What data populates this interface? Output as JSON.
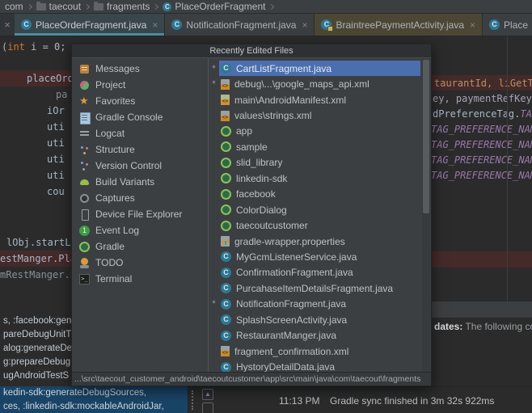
{
  "breadcrumb": {
    "items": [
      {
        "label": "com"
      },
      {
        "label": "taecout"
      },
      {
        "label": "fragments"
      },
      {
        "label": "PlaceOrderFragment"
      }
    ]
  },
  "tabs": [
    {
      "label": "PlaceOrderFragment.java",
      "close": "×",
      "state": "selected"
    },
    {
      "label": "NotificationFragment.java",
      "close": "×",
      "state": "normal"
    },
    {
      "label": "BraintreePaymentActivity.java",
      "close": "×",
      "state": "readonly"
    },
    {
      "label": "Place",
      "close": "",
      "state": "partial"
    }
  ],
  "leading_close": "×",
  "popup": {
    "title": "Recently Edited Files",
    "tool_windows": [
      {
        "label": "Messages",
        "icon": "messages-icon"
      },
      {
        "label": "Project",
        "icon": "project-icon"
      },
      {
        "label": "Favorites",
        "icon": "star-icon"
      },
      {
        "label": "Gradle Console",
        "icon": "gradle-console-icon"
      },
      {
        "label": "Logcat",
        "icon": "logcat-icon"
      },
      {
        "label": "Structure",
        "icon": "structure-icon"
      },
      {
        "label": "Version Control",
        "icon": "version-control-icon"
      },
      {
        "label": "Build Variants",
        "icon": "android-icon"
      },
      {
        "label": "Captures",
        "icon": "captures-icon"
      },
      {
        "label": "Device File Explorer",
        "icon": "phone-icon"
      },
      {
        "label": "Event Log",
        "icon": "event-log-icon"
      },
      {
        "label": "Gradle",
        "icon": "gradle-icon"
      },
      {
        "label": "TODO",
        "icon": "todo-icon"
      },
      {
        "label": "Terminal",
        "icon": "terminal-icon"
      }
    ],
    "files": [
      {
        "label": "CartListFragment.java",
        "icon": "class-icon",
        "marker": "*",
        "selected": true
      },
      {
        "label": "debug\\...\\google_maps_api.xml",
        "icon": "xml-icon",
        "marker": "*",
        "selected": false
      },
      {
        "label": "main\\AndroidManifest.xml",
        "icon": "manifest-icon",
        "marker": "",
        "selected": false
      },
      {
        "label": "values\\strings.xml",
        "icon": "xml-icon",
        "marker": "",
        "selected": false
      },
      {
        "label": "app",
        "icon": "gradle-icon",
        "marker": "",
        "selected": false
      },
      {
        "label": "sample",
        "icon": "gradle-icon",
        "marker": "",
        "selected": false
      },
      {
        "label": "slid_library",
        "icon": "gradle-icon",
        "marker": "",
        "selected": false
      },
      {
        "label": "linkedin-sdk",
        "icon": "gradle-icon",
        "marker": "",
        "selected": false
      },
      {
        "label": "facebook",
        "icon": "gradle-icon",
        "marker": "",
        "selected": false
      },
      {
        "label": "ColorDialog",
        "icon": "gradle-icon",
        "marker": "",
        "selected": false
      },
      {
        "label": "taecoutcustomer",
        "icon": "gradle-icon",
        "marker": "",
        "selected": false
      },
      {
        "label": "gradle-wrapper.properties",
        "icon": "properties-icon",
        "marker": "",
        "selected": false
      },
      {
        "label": "MyGcmListenerService.java",
        "icon": "class-icon",
        "marker": "",
        "selected": false
      },
      {
        "label": "ConfirmationFragment.java",
        "icon": "class-icon",
        "marker": "",
        "selected": false
      },
      {
        "label": "PurcahaseItemDetailsFragment.java",
        "icon": "class-icon",
        "marker": "",
        "selected": false
      },
      {
        "label": "NotificationFragment.java",
        "icon": "class-icon",
        "marker": "*",
        "selected": false
      },
      {
        "label": "SplashScreenActivity.java",
        "icon": "class-icon",
        "marker": "",
        "selected": false
      },
      {
        "label": "RestaurantManger.java",
        "icon": "class-icon",
        "marker": "",
        "selected": false
      },
      {
        "label": "fragment_confirmation.xml",
        "icon": "xml-icon",
        "marker": "",
        "selected": false
      },
      {
        "label": "HystoryDetailData.java",
        "icon": "class-icon",
        "marker": "",
        "selected": false
      }
    ],
    "path": "...\\src\\taecout_customer_android\\taecoutcustomer\\app\\src\\main\\java\\com\\taecout\\fragments"
  },
  "editor_left": {
    "top": {
      "pre": "(",
      "kw": "int",
      "rest": " i = 0;"
    },
    "l1": "placeOrderM",
    "l2": "pa",
    "l3": "iOr",
    "l4": "uti",
    "l5": "uti",
    "l6": "uti",
    "l7": "uti",
    "l8": "cou",
    "l9": "lObj.startLo",
    "l10": "estManger.Pla",
    "l11": "mRestManger.P"
  },
  "editor_right": {
    "l1": "taurantId, liGetTe",
    "l2": "ey, paymentRefKey,",
    "l3pre": "dPreferenceTag.",
    "l3tag": "TAG",
    "t1": "TAG_PREFERENCE_NAME",
    "t2": "TAG_PREFERENCE_NAME",
    "t3": "TAG_PREFERENCE_NAME",
    "t4": "TAG_PREFERENCE_NAME"
  },
  "console": {
    "l1": "s, :facebook:gen",
    "l2": "pareDebugUnitT",
    "l3": "alog:generateDeb",
    "l4": "g:prepareDebug",
    "l5": "ugAndroidTestS",
    "s1": "kedin-sdk:generateDebugSources,",
    "s2": "ces, :linkedin-sdk:mockableAndroidJar,"
  },
  "event_log": {
    "bold": "dates:",
    "rest": " The following co"
  },
  "status": {
    "time": "11:13 PM",
    "message": "Gradle sync finished in 3m 32s 922ms"
  },
  "colors": {
    "selection_blue": "#4b6eaf",
    "tab_underline": "#4c8d9e",
    "line_highlight": "#452a2a",
    "console_selection": "#1a4466",
    "panel_bg": "#3c3f41",
    "editor_bg": "#2b2b2b"
  }
}
